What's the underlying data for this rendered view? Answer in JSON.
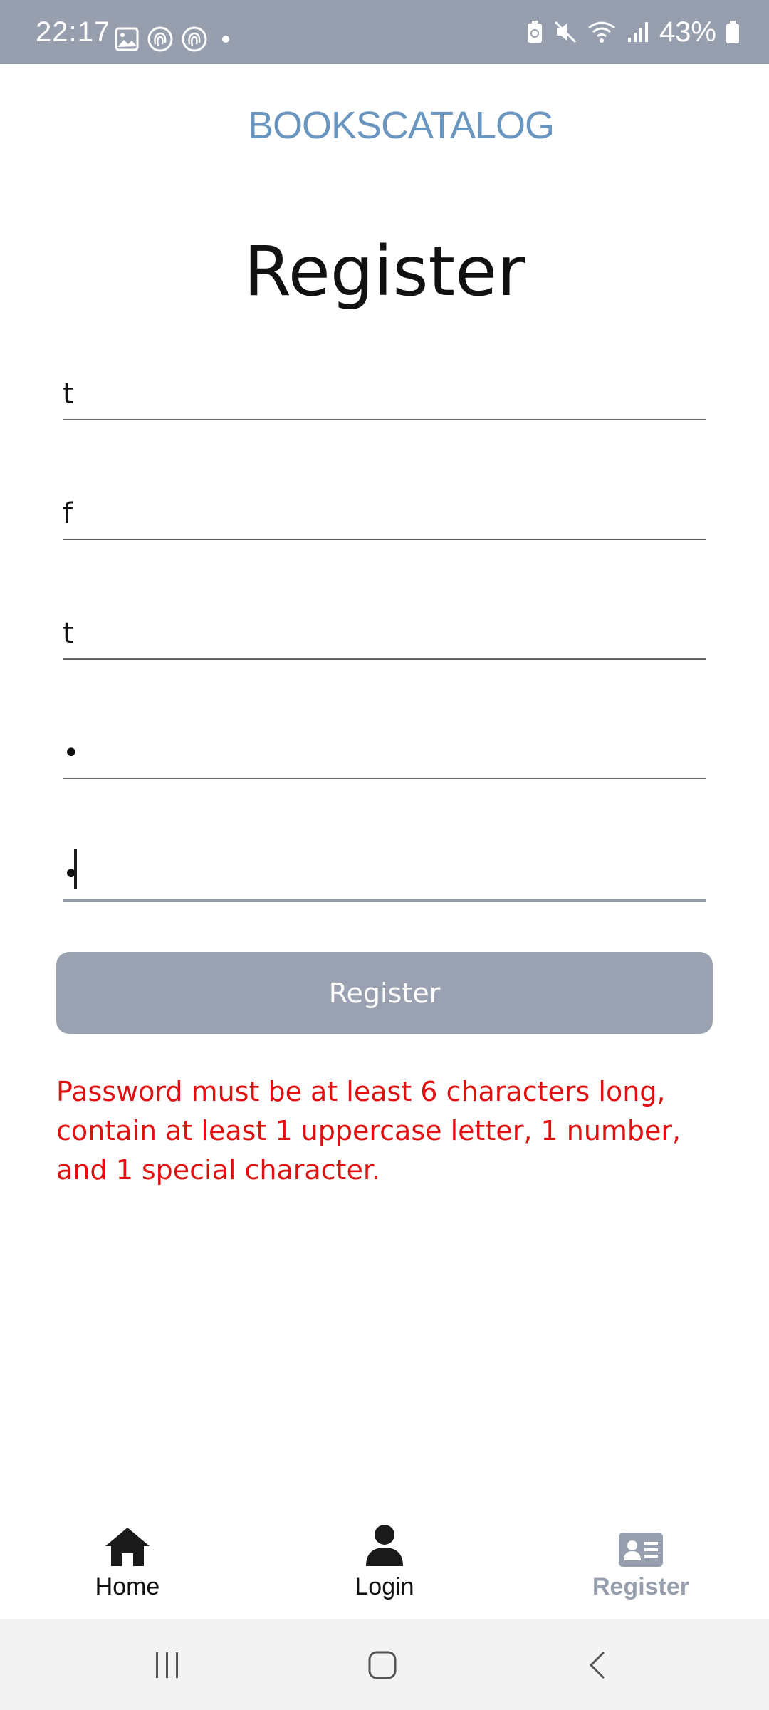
{
  "status_bar": {
    "time": "22:17",
    "battery": "43%",
    "left_icons": [
      "image-icon",
      "fingerprint-icon",
      "fingerprint-icon",
      "dot-icon"
    ],
    "right_icons": [
      "battery-saver-icon",
      "mute-icon",
      "wifi-icon",
      "signal-icon",
      "battery-icon"
    ]
  },
  "header": {
    "brand": "BOOKSCATALOG"
  },
  "form": {
    "title": "Register",
    "fields": [
      {
        "value": "t"
      },
      {
        "value": "f"
      },
      {
        "value": "t"
      },
      {
        "value": "•"
      },
      {
        "value": "•"
      }
    ],
    "submit_label": "Register",
    "error": "Password must be at least 6 characters long, contain at least 1 uppercase letter, 1 number, and 1 special character."
  },
  "tabbar": {
    "tabs": [
      {
        "label": "Home",
        "icon": "home-icon"
      },
      {
        "label": "Login",
        "icon": "user-icon"
      },
      {
        "label": "Register",
        "icon": "id-card-icon",
        "active": true
      }
    ]
  },
  "colors": {
    "accent": "#979fae",
    "brand": "#6a95bf",
    "error": "#e01010"
  }
}
